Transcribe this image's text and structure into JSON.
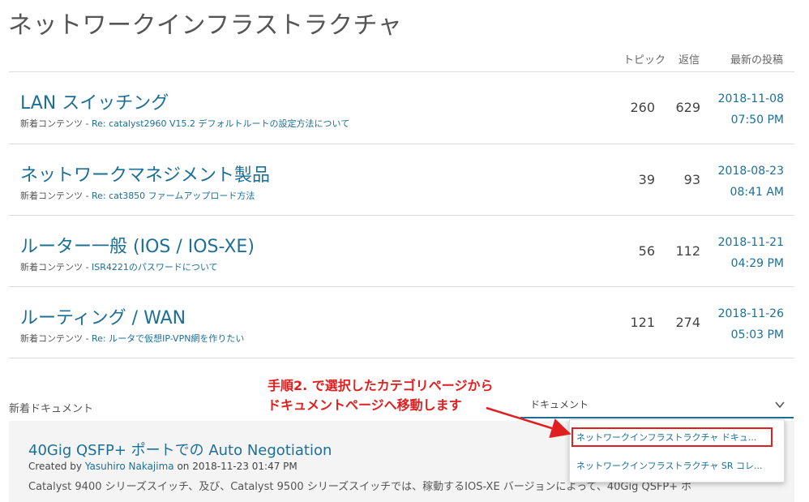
{
  "page": {
    "title": "ネットワークインフラストラクチャ"
  },
  "columns": {
    "topics": "トピック",
    "replies": "返信",
    "latest": "最新の投稿"
  },
  "categories": [
    {
      "title": "LAN スイッチング",
      "prefix": "新着コンテンツ - ",
      "link": "Re: catalyst2960 V15.2 デフォルトルートの設定方法について",
      "topics": "260",
      "replies": "629",
      "date": "2018-11-08",
      "time": "07:50 PM"
    },
    {
      "title": "ネットワークマネジメント製品",
      "prefix": "新着コンテンツ - ",
      "link": "Re: cat3850 ファームアップロード方法",
      "topics": "39",
      "replies": "93",
      "date": "2018-08-23",
      "time": "08:41 AM"
    },
    {
      "title": "ルーター一般 (IOS / IOS-XE)",
      "prefix": "新着コンテンツ - ",
      "link": "ISR4221のパスワードについて",
      "topics": "56",
      "replies": "112",
      "date": "2018-11-21",
      "time": "04:29 PM"
    },
    {
      "title": "ルーティング / WAN",
      "prefix": "新着コンテンツ - ",
      "link": "Re: ルータで仮想IP-VPN網を作りたい",
      "topics": "121",
      "replies": "274",
      "date": "2018-11-26",
      "time": "05:03 PM"
    }
  ],
  "new_docs": {
    "label": "新着ドキュメント"
  },
  "dropdown": {
    "value": "ドキュメント",
    "options": [
      "ネットワークインフラストラクチャ ドキュ...",
      "ネットワークインフラストラクチャ SR コレ..."
    ]
  },
  "annotation": {
    "line1": "手順2. で選択したカテゴリページから",
    "line2": "ドキュメントページへ移動します",
    "color": "#e02020"
  },
  "doc": {
    "title": "40Gig QSFP+ ポートでの Auto Negotiation",
    "created_by_label": "Created by ",
    "author": "Yasuhiro Nakajima",
    "on": " on 2018-11-23 01:47 PM",
    "snippet": "Catalyst 9400 シリーズスイッチ、及び、Catalyst 9500 シリーズスイッチでは、稼動するIOS-XE バージョンによって、40Gig QSFP+ ポ"
  },
  "colors": {
    "link": "#1d6f96",
    "accent": "#e02020"
  }
}
